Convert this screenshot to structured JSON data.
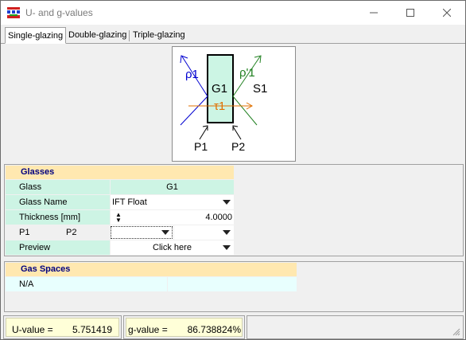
{
  "window": {
    "title": "U- and g-values"
  },
  "tabs": [
    {
      "label": "Single-glazing",
      "active": true
    },
    {
      "label": "Double-glazing",
      "active": false
    },
    {
      "label": "Triple-glazing",
      "active": false
    }
  ],
  "diagram": {
    "pane_label": "G1",
    "space_label": "S1",
    "reflect_front": "ρ1",
    "reflect_back": "ρ'1",
    "transmit": "τ1",
    "point1": "P1",
    "point2": "P2",
    "colors": {
      "pane_fill": "#ccf5e4",
      "reflect_front": "#0000d0",
      "reflect_back": "#208020",
      "transmit": "#e07000"
    }
  },
  "glasses": {
    "header": "Glasses",
    "rows": {
      "glass": {
        "label": "Glass",
        "value": "G1"
      },
      "glass_name": {
        "label": "Glass Name",
        "value": "IFT Float"
      },
      "thickness": {
        "label": "Thickness [mm]",
        "value": "4.0000"
      },
      "p1p2": {
        "label1": "P1",
        "label2": "P2"
      },
      "preview": {
        "label": "Preview",
        "value": "Click here"
      }
    }
  },
  "gas_spaces": {
    "header": "Gas Spaces",
    "value": "N/A"
  },
  "status": {
    "u_label": "U-value =",
    "u_value": "5.751419",
    "g_label": "g-value =",
    "g_value": "86.738824%"
  }
}
